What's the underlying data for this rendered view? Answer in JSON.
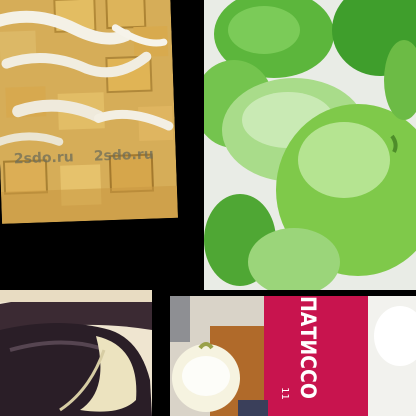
{
  "collage": {
    "panels": [
      {
        "subject": "fried onion and squash cubes"
      },
      {
        "subject": "green pattypan squashes"
      },
      {
        "subject": "sliced eggplant"
      },
      {
        "subject": "pattypan squash and seed packet"
      }
    ],
    "watermark_text": "2sdo.ru",
    "packet_title": "ПАТИССО",
    "packet_number": "11",
    "colors": {
      "background": "#000000",
      "packet": "#c8144e",
      "squash_green": "#7fc94a"
    }
  }
}
